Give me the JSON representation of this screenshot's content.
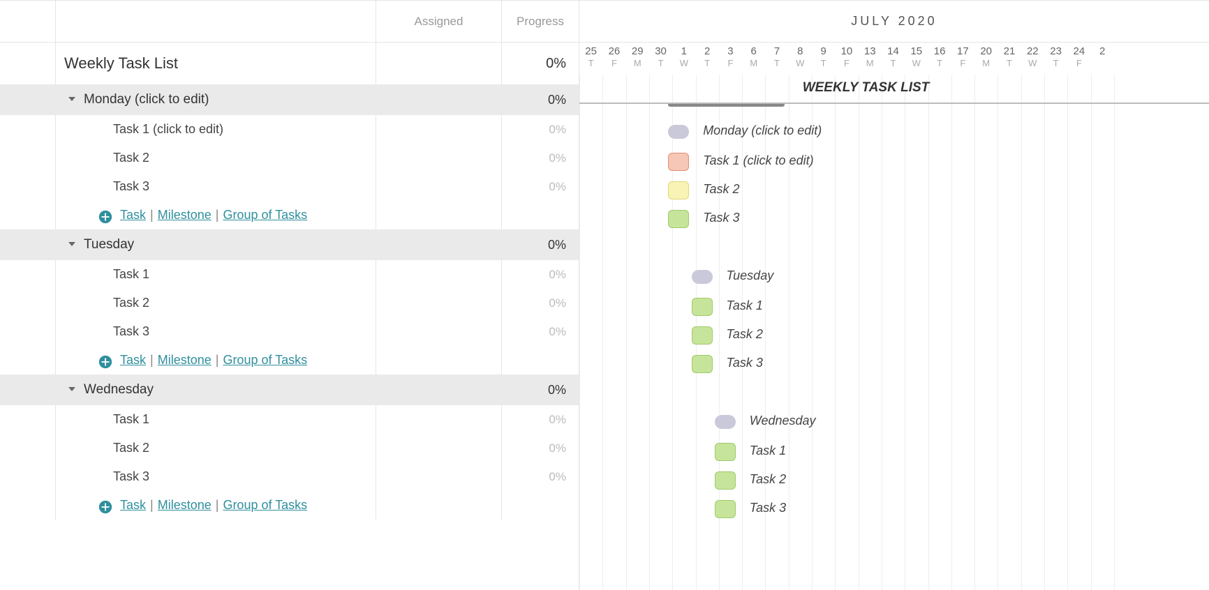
{
  "columns": {
    "assigned": "Assigned",
    "progress": "Progress"
  },
  "timeline": {
    "month_label": "JULY 2020",
    "days": [
      {
        "num": "25",
        "letter": "T"
      },
      {
        "num": "26",
        "letter": "F"
      },
      {
        "num": "29",
        "letter": "M"
      },
      {
        "num": "30",
        "letter": "T"
      },
      {
        "num": "1",
        "letter": "W"
      },
      {
        "num": "2",
        "letter": "T"
      },
      {
        "num": "3",
        "letter": "F"
      },
      {
        "num": "6",
        "letter": "M"
      },
      {
        "num": "7",
        "letter": "T"
      },
      {
        "num": "8",
        "letter": "W"
      },
      {
        "num": "9",
        "letter": "T"
      },
      {
        "num": "10",
        "letter": "F"
      },
      {
        "num": "13",
        "letter": "M"
      },
      {
        "num": "14",
        "letter": "T"
      },
      {
        "num": "15",
        "letter": "W"
      },
      {
        "num": "16",
        "letter": "T"
      },
      {
        "num": "17",
        "letter": "F"
      },
      {
        "num": "20",
        "letter": "M"
      },
      {
        "num": "21",
        "letter": "T"
      },
      {
        "num": "22",
        "letter": "W"
      },
      {
        "num": "23",
        "letter": "T"
      },
      {
        "num": "24",
        "letter": "F"
      },
      {
        "num": "2",
        "letter": ""
      }
    ]
  },
  "project": {
    "title": "Weekly Task List",
    "progress": "0%",
    "gantt_title": "WEEKLY TASK LIST"
  },
  "add_actions": {
    "task": "Task",
    "milestone": "Milestone",
    "group": "Group of Tasks"
  },
  "groups": [
    {
      "name": "Monday (click to edit)",
      "progress": "0%",
      "gantt_label": "Monday (click to edit)",
      "col": 4,
      "tasks": [
        {
          "name": "Task 1 (click to edit)",
          "progress": "0%",
          "gantt_label": "Task 1 (click to edit)",
          "color": "red",
          "col": 4
        },
        {
          "name": "Task 2",
          "progress": "0%",
          "gantt_label": "Task 2",
          "color": "yellow",
          "col": 4
        },
        {
          "name": "Task 3",
          "progress": "0%",
          "gantt_label": "Task 3",
          "color": "green",
          "col": 4
        }
      ]
    },
    {
      "name": "Tuesday",
      "progress": "0%",
      "gantt_label": "Tuesday",
      "col": 5,
      "tasks": [
        {
          "name": "Task 1",
          "progress": "0%",
          "gantt_label": "Task 1",
          "color": "green",
          "col": 5
        },
        {
          "name": "Task 2",
          "progress": "0%",
          "gantt_label": "Task 2",
          "color": "green",
          "col": 5
        },
        {
          "name": "Task 3",
          "progress": "0%",
          "gantt_label": "Task 3",
          "color": "green",
          "col": 5
        }
      ]
    },
    {
      "name": "Wednesday",
      "progress": "0%",
      "gantt_label": "Wednesday",
      "col": 6,
      "tasks": [
        {
          "name": "Task 1",
          "progress": "0%",
          "gantt_label": "Task 1",
          "color": "green",
          "col": 6
        },
        {
          "name": "Task 2",
          "progress": "0%",
          "gantt_label": "Task 2",
          "color": "green",
          "col": 6
        },
        {
          "name": "Task 3",
          "progress": "0%",
          "gantt_label": "Task 3",
          "color": "green",
          "col": 6
        }
      ]
    }
  ]
}
